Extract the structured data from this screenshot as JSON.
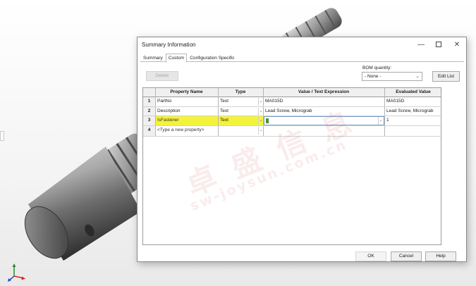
{
  "window": {
    "title": "Summary Information",
    "minimize_symbol": "—",
    "close_symbol": "✕"
  },
  "tabs": [
    {
      "label": "Summary",
      "active": false
    },
    {
      "label": "Custom",
      "active": true
    },
    {
      "label": "Configuration Specific",
      "active": false
    }
  ],
  "toolbar": {
    "delete_label": "Delete",
    "bom_quantity_label": "BOM quantity:",
    "bom_quantity_value": "- None -",
    "edit_list_label": "Edit List"
  },
  "grid": {
    "headers": [
      "Property Name",
      "Type",
      "Value / Text Expression",
      "Evaluated Value"
    ],
    "rows": [
      {
        "num": "1",
        "name": "PartNo",
        "type": "Text",
        "value": "MA015D",
        "evaluated": "MA015D",
        "highlighted": false
      },
      {
        "num": "2",
        "name": "Description",
        "type": "Text",
        "value": "Lead Screw, Micrograb",
        "evaluated": "Lead Screw, Micrograb",
        "highlighted": false
      },
      {
        "num": "3",
        "name": "IsFastener",
        "type": "Text",
        "value": "1",
        "evaluated": "1",
        "highlighted": true
      },
      {
        "num": "4",
        "name": "<Type a new property>",
        "type": "",
        "value": "",
        "evaluated": "",
        "highlighted": false
      }
    ]
  },
  "buttons": {
    "ok": "OK",
    "cancel": "Cancel",
    "help": "Help"
  },
  "watermark": {
    "line1": "卓 盛 信 息",
    "line2": "sw-joysun.com.cn"
  },
  "colors": {
    "highlight": "#f4f33b",
    "value_cursor": "#4f8f3a"
  }
}
